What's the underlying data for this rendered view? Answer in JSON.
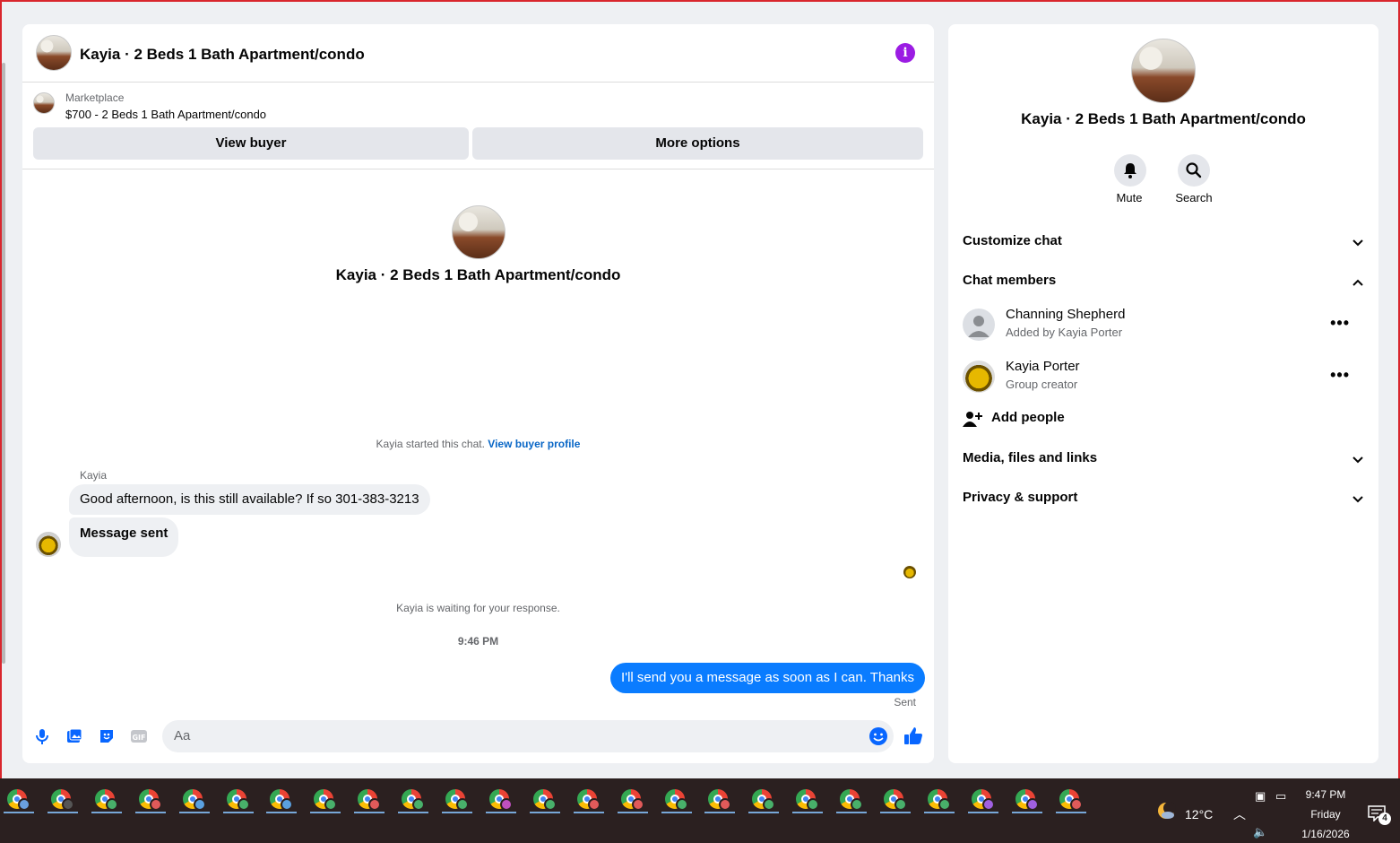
{
  "chat": {
    "title": "Kayia · 2 Beds 1 Bath Apartment/condo",
    "marketplace_label": "Marketplace",
    "listing": "$700 - 2 Beds 1 Bath Apartment/condo",
    "view_buyer": "View buyer",
    "more_options": "More options",
    "center_title": "Kayia · 2 Beds 1 Bath Apartment/condo",
    "started_text": "Kayia started this chat.",
    "view_buyer_profile": "View buyer profile",
    "sender_name": "Kayia",
    "messages_in": [
      "Good afternoon, is this still available? If so 301-383-3213",
      "Message sent"
    ],
    "waiting_text": "Kayia is waiting for your response.",
    "timestamp": "9:46 PM",
    "message_out": "I'll send you a message as soon as I can. Thanks",
    "sent_label": "Sent",
    "input_placeholder": "Aa"
  },
  "info_panel": {
    "title": "Kayia · 2 Beds 1 Bath Apartment/condo",
    "mute_label": "Mute",
    "search_label": "Search",
    "sections": {
      "customize": "Customize chat",
      "members": "Chat members",
      "media": "Media, files and links",
      "privacy": "Privacy & support"
    },
    "members": [
      {
        "name": "Channing Shepherd",
        "sub": "Added by Kayia Porter"
      },
      {
        "name": "Kayia Porter",
        "sub": "Group creator"
      }
    ],
    "add_people": "Add people"
  },
  "taskbar": {
    "items": [
      "chrome-profile-1",
      "chrome-profile-2",
      "chrome-profile-3",
      "chrome-profile-4",
      "chrome-profile-5",
      "chrome-profile-6",
      "chrome-profile-7",
      "chrome-profile-8",
      "chrome-profile-9",
      "chrome-profile-10",
      "chrome-profile-11",
      "chrome-profile-12",
      "chrome-profile-13",
      "chrome-profile-14",
      "chrome-profile-15",
      "chrome-profile-16",
      "chrome-profile-17",
      "chrome-profile-18",
      "chrome-profile-19",
      "chrome-profile-20",
      "chrome-profile-21",
      "chrome-profile-22",
      "chrome-profile-23",
      "chrome-profile-24",
      "chrome-profile-25"
    ],
    "badge_colors": [
      "#6a9fe0",
      "#555555",
      "#48b06a",
      "#e05a5a",
      "#5aa0e0",
      "#48b06a",
      "#5aa0e0",
      "#48b06a",
      "#e05a5a",
      "#48b06a",
      "#48b06a",
      "#c050c0",
      "#48b06a",
      "#e05a5a",
      "#e05a5a",
      "#48b06a",
      "#e05a5a",
      "#48b06a",
      "#48b06a",
      "#48b06a",
      "#48b06a",
      "#48b06a",
      "#a060e0",
      "#a060e0",
      "#e05a5a"
    ],
    "weather": "12°C",
    "time": "9:47 PM",
    "day": "Friday",
    "date": "1/16/2026",
    "notification_count": "4"
  },
  "colors": {
    "accent": "#0a7cff",
    "info": "#9b1ce3",
    "link": "#0866c6"
  }
}
